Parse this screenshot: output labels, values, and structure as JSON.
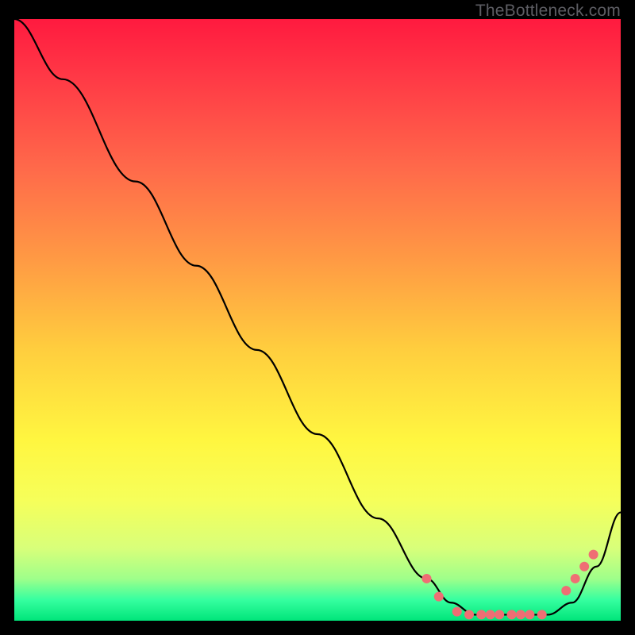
{
  "watermark": "TheBottleneck.com",
  "chart_data": {
    "type": "line",
    "title": "",
    "xlabel": "",
    "ylabel": "",
    "xlim": [
      0,
      100
    ],
    "ylim": [
      0,
      100
    ],
    "grid": false,
    "legend": false,
    "background_gradient_stops": [
      {
        "offset": 0.0,
        "color": "#ff1a3f"
      },
      {
        "offset": 0.1,
        "color": "#ff3a46"
      },
      {
        "offset": 0.25,
        "color": "#ff6a4a"
      },
      {
        "offset": 0.4,
        "color": "#ff9a44"
      },
      {
        "offset": 0.55,
        "color": "#ffce3e"
      },
      {
        "offset": 0.7,
        "color": "#fff640"
      },
      {
        "offset": 0.8,
        "color": "#f6ff5a"
      },
      {
        "offset": 0.88,
        "color": "#d8ff7a"
      },
      {
        "offset": 0.93,
        "color": "#9fff8a"
      },
      {
        "offset": 0.965,
        "color": "#36ffa0"
      },
      {
        "offset": 1.0,
        "color": "#00e57a"
      }
    ],
    "series": [
      {
        "name": "bottleneck-curve",
        "color": "#000000",
        "x": [
          0,
          8,
          20,
          30,
          40,
          50,
          60,
          68,
          72,
          76,
          80,
          84,
          88,
          92,
          96,
          100
        ],
        "y": [
          100,
          90,
          73,
          59,
          45,
          31,
          17,
          7,
          3,
          1,
          1,
          1,
          1,
          3,
          9,
          18
        ]
      }
    ],
    "markers": {
      "name": "highlight-points",
      "color": "#ef6e74",
      "radius": 6,
      "points": [
        {
          "x": 68,
          "y": 7
        },
        {
          "x": 70,
          "y": 4
        },
        {
          "x": 73,
          "y": 1.5
        },
        {
          "x": 75,
          "y": 1
        },
        {
          "x": 77,
          "y": 1
        },
        {
          "x": 78.5,
          "y": 1
        },
        {
          "x": 80,
          "y": 1
        },
        {
          "x": 82,
          "y": 1
        },
        {
          "x": 83.5,
          "y": 1
        },
        {
          "x": 85,
          "y": 1
        },
        {
          "x": 87,
          "y": 1
        },
        {
          "x": 91,
          "y": 5
        },
        {
          "x": 92.5,
          "y": 7
        },
        {
          "x": 94,
          "y": 9
        },
        {
          "x": 95.5,
          "y": 11
        }
      ]
    }
  }
}
